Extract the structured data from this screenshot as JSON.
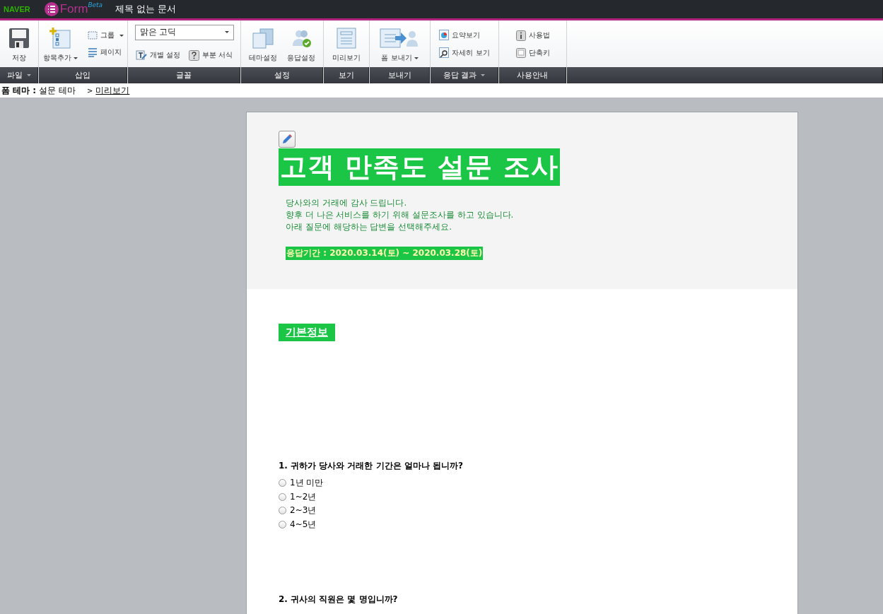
{
  "app_bar": {
    "logo": "NAVER",
    "product": "Form",
    "product_badge": "Beta",
    "document_title": "제목 없는 문서"
  },
  "ribbon": [
    {
      "label": "파일",
      "has_menu": true,
      "tools": [
        {
          "kind": "large",
          "label": "저장",
          "has_menu": false
        }
      ]
    },
    {
      "label": "삽입",
      "has_menu": false,
      "tools": [
        {
          "kind": "large",
          "label": "항목추가",
          "has_menu": true
        },
        {
          "kind": "small",
          "label": "그룹",
          "has_menu": true
        },
        {
          "kind": "small",
          "label": "페이지",
          "has_menu": false
        }
      ]
    },
    {
      "label": "글꼴",
      "has_menu": false,
      "tools": [
        {
          "kind": "select",
          "label": "맑은 고딕",
          "has_menu": true
        },
        {
          "kind": "small",
          "label": "개별 설정",
          "has_menu": false
        },
        {
          "kind": "small",
          "label": "부분 서식",
          "has_menu": false
        }
      ]
    },
    {
      "label": "설정",
      "has_menu": false,
      "tools": [
        {
          "kind": "large",
          "label": "테마설정",
          "has_menu": false
        },
        {
          "kind": "large",
          "label": "응답설정",
          "has_menu": false
        }
      ]
    },
    {
      "label": "보기",
      "has_menu": false,
      "tools": [
        {
          "kind": "large",
          "label": "미리보기",
          "has_menu": false
        }
      ]
    },
    {
      "label": "보내기",
      "has_menu": false,
      "tools": [
        {
          "kind": "large",
          "label": "폼 보내기",
          "has_menu": true
        }
      ]
    },
    {
      "label": "응답 결과",
      "has_menu": true,
      "tools": [
        {
          "kind": "small",
          "label": "요약보기",
          "has_menu": false
        },
        {
          "kind": "small",
          "label": "자세히 보기",
          "has_menu": false
        }
      ]
    },
    {
      "label": "사용안내",
      "has_menu": false,
      "tools": [
        {
          "kind": "small",
          "label": "사용법",
          "has_menu": false
        },
        {
          "kind": "small",
          "label": "단축키",
          "has_menu": false
        }
      ]
    }
  ],
  "breadcrumb": {
    "label": "폼 테마 :",
    "theme": "설문 테마",
    "separator": ">",
    "link": "미리보기"
  },
  "form": {
    "title": "고객 만족도 설문 조사",
    "intro": [
      "당사와의 거래에 감사 드립니다.",
      "향후 더 나은 서비스를 하기 위해 설문조사를 하고 있습니다.",
      "아래 질문에 해당하는 답변을 선택해주세요."
    ],
    "period": "응답기간 : 2020.03.14(토) ~ 2020.03.28(토)",
    "section": "기본정보",
    "questions": [
      {
        "text": "1. 귀하가 당사와 거래한 기간은 얼마나 됩니까?",
        "options": [
          {
            "label": "1년 미만",
            "selected": false
          },
          {
            "label": "1~2년",
            "selected": false
          },
          {
            "label": "2~3년",
            "selected": false
          },
          {
            "label": "4~5년",
            "selected": false
          }
        ]
      },
      {
        "text": "2. 귀사의 직원은 몇 명입니까?"
      }
    ]
  }
}
